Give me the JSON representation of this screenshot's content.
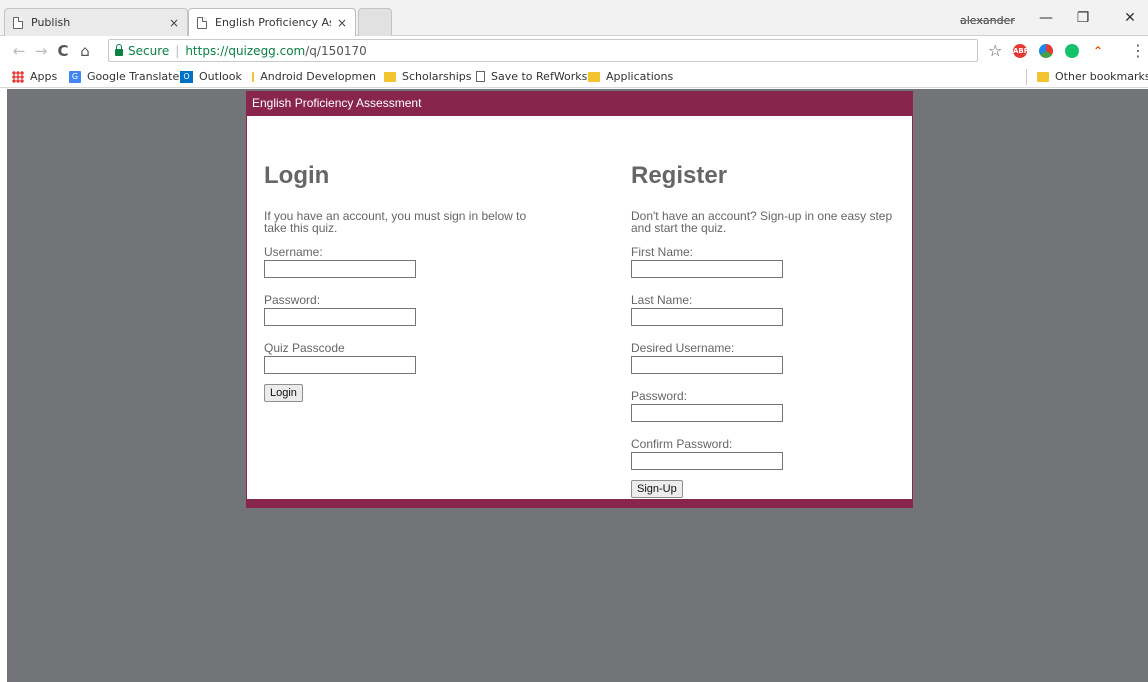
{
  "browser": {
    "tabs": [
      {
        "title": "Publish",
        "close": "×"
      },
      {
        "title": "English Proficiency Asses",
        "close": "×"
      }
    ],
    "profile": "alexander",
    "window": {
      "minimize": "—",
      "restore": "❐",
      "close": "✕"
    },
    "address": {
      "secure_label": "Secure",
      "separator": "|",
      "scheme": "https://",
      "host": "quizegg.com",
      "path": "/q/150170"
    },
    "nav": {
      "back": "←",
      "forward": "→",
      "reload": "C",
      "home": "⌂"
    },
    "toolbar_icons": {
      "star": "☆",
      "menu": "⋮",
      "abp": "ABP"
    },
    "bookmarks": [
      {
        "label": "Apps",
        "icon": "apps-icon"
      },
      {
        "label": "Google Translate",
        "icon": "google-translate-icon"
      },
      {
        "label": "Outlook",
        "icon": "outlook-icon"
      },
      {
        "label": "Android Developmen",
        "icon": "folder-icon"
      },
      {
        "label": "Scholarships",
        "icon": "folder-icon"
      },
      {
        "label": "Save to RefWorks",
        "icon": "page-icon"
      },
      {
        "label": "Applications",
        "icon": "folder-icon"
      }
    ],
    "other_bookmarks": "Other bookmarks"
  },
  "quiz": {
    "header": "English Proficiency Assessment",
    "colors": {
      "accent": "#88254d",
      "background": "#737478"
    },
    "login": {
      "title": "Login",
      "intro": "If you have an account, you must sign in below to take this quiz.",
      "fields": [
        "Username:",
        "Password:",
        "Quiz Passcode"
      ],
      "button": "Login"
    },
    "register": {
      "title": "Register",
      "intro": "Don't have an account? Sign-up in one easy step and start the quiz.",
      "fields": [
        "First Name:",
        "Last Name:",
        "Desired Username:",
        "Password:",
        "Confirm Password:"
      ],
      "button": "Sign-Up"
    }
  }
}
